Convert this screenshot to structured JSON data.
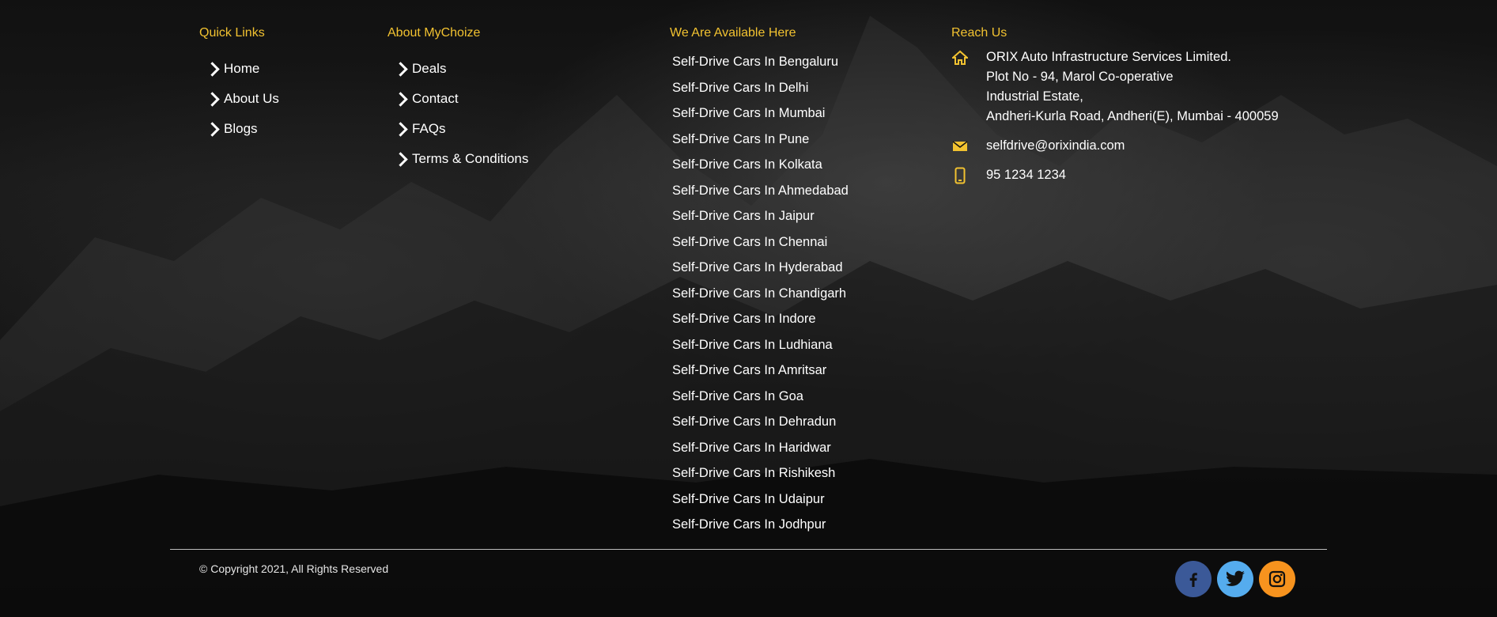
{
  "quick_links": {
    "heading": "Quick Links",
    "items": [
      "Home",
      "About Us",
      "Blogs"
    ]
  },
  "about": {
    "heading": "About MyChoize",
    "items": [
      "Deals",
      "Contact",
      "FAQs",
      "Terms & Conditions"
    ]
  },
  "available": {
    "heading": "We Are Available Here",
    "cities": [
      "Self-Drive Cars In Bengaluru",
      "Self-Drive Cars In Delhi",
      "Self-Drive Cars In Mumbai",
      "Self-Drive Cars In Pune",
      "Self-Drive Cars In Kolkata",
      "Self-Drive Cars In Ahmedabad",
      "Self-Drive Cars In Jaipur",
      "Self-Drive Cars In Chennai",
      "Self-Drive Cars In Hyderabad",
      "Self-Drive Cars In Chandigarh",
      "Self-Drive Cars In Indore",
      "Self-Drive Cars In Ludhiana",
      "Self-Drive Cars In Amritsar",
      "Self-Drive Cars In Goa",
      "Self-Drive Cars In Dehradun",
      "Self-Drive Cars In Haridwar",
      "Self-Drive Cars In Rishikesh",
      "Self-Drive Cars In Udaipur",
      "Self-Drive Cars In Jodhpur"
    ]
  },
  "reach": {
    "heading": "Reach Us",
    "address_lines": [
      "ORIX Auto Infrastructure Services Limited.",
      "Plot No - 94, Marol Co-operative",
      "Industrial Estate,",
      "Andheri-Kurla Road, Andheri(E), Mumbai - 400059"
    ],
    "email": "selfdrive@orixindia.com",
    "phone": "95 1234 1234",
    "icons": [
      "home-icon",
      "mail-icon",
      "phone-icon"
    ]
  },
  "copyright": "© Copyright 2021, All Rights Reserved",
  "social": [
    {
      "name": "facebook-icon",
      "glyph": "f",
      "color": "#3b5998"
    },
    {
      "name": "twitter-icon",
      "glyph": "t",
      "color": "#55acee"
    },
    {
      "name": "instagram-icon",
      "glyph": "ig",
      "color": "#f7931e"
    }
  ],
  "colors": {
    "accent": "#f2c230",
    "text": "#ffffff",
    "background": "#0b0b0b"
  }
}
